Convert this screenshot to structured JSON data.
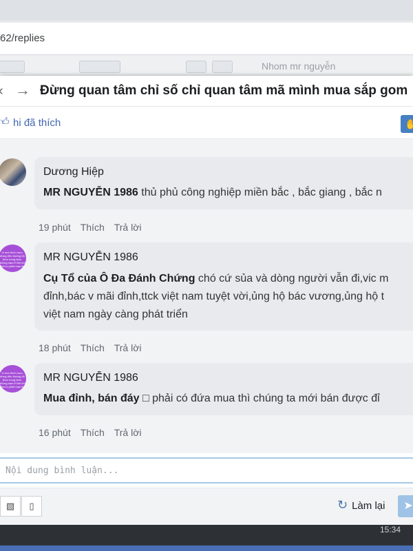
{
  "browser": {
    "url_fragment": "62/replies"
  },
  "background_toolbar": {
    "search_placeholder": "Nhom mr nguyễn"
  },
  "modal": {
    "title": "Đừng quan tâm chỉ số chỉ quan tâm mã mình mua sắp gom",
    "like_text": "hi đã thích"
  },
  "comments": [
    {
      "author": "Dương Hiệp",
      "tag": "MR NGUYỄN 1986",
      "text": " thủ phủ công nghiệp miền bắc , bắc giang , bắc n",
      "time": "19 phút",
      "like": "Thích",
      "reply": "Trả lời"
    },
    {
      "author": "MR NGUYỄN 1986",
      "tag": "Cụ Tổ của Ô Đa Đánh Chứng",
      "text_lines": [
        " chó cứ sủa và dòng người vẫn đi,vic m",
        "đỉnh,bác v mãi đỉnh,ttck việt nam tuyệt vời,ủng hộ bác vương,ủng hộ t",
        "việt nam ngày càng phát triển"
      ],
      "time": "18 phút",
      "like": "Thích",
      "reply": "Trả lời"
    },
    {
      "author": "MR NGUYỄN 1986",
      "tag": "Mua đỉnh, bán đáy",
      "text": " □ phải có đứa mua thì chúng ta mới bán được đỉ",
      "time": "16 phút",
      "like": "Thích",
      "reply": "Trả lời"
    }
  ],
  "input": {
    "placeholder": "Nội dung bình luận..."
  },
  "toolbar": {
    "reset_label": "Làm lại"
  },
  "avatar_text": "Vì anh thích mực, đừng đến đường đó thức trong lành. Những ham ể Nhỉ nhỏ đơn lo phiên bạn ẩn"
}
